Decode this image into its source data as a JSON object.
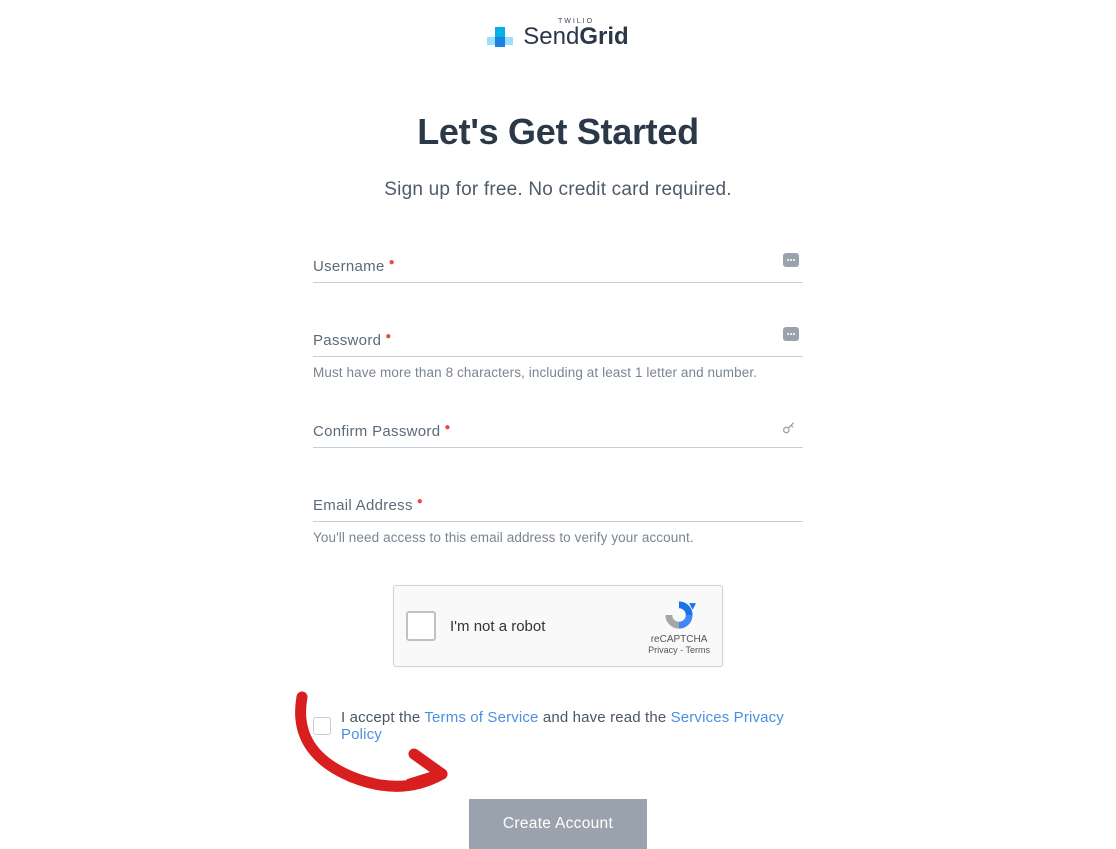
{
  "logo": {
    "parent_brand": "TWILIO",
    "name_light": "Send",
    "name_bold": "Grid"
  },
  "heading": "Let's Get Started",
  "subtitle": "Sign up for free. No credit card required.",
  "fields": {
    "username": {
      "label": "Username",
      "value": ""
    },
    "password": {
      "label": "Password",
      "value": "",
      "hint": "Must have more than 8 characters, including at least 1 letter and number."
    },
    "confirm_password": {
      "label": "Confirm Password",
      "value": ""
    },
    "email": {
      "label": "Email Address",
      "value": "",
      "hint": "You'll need access to this email address to verify your account."
    }
  },
  "recaptcha": {
    "label": "I'm not a robot",
    "brand": "reCAPTCHA",
    "privacy": "Privacy",
    "terms": "Terms"
  },
  "terms": {
    "prefix": "I accept the ",
    "tos_link": "Terms of Service",
    "middle": " and have read the ",
    "privacy_link": "Services Privacy Policy"
  },
  "submit_label": "Create Account"
}
